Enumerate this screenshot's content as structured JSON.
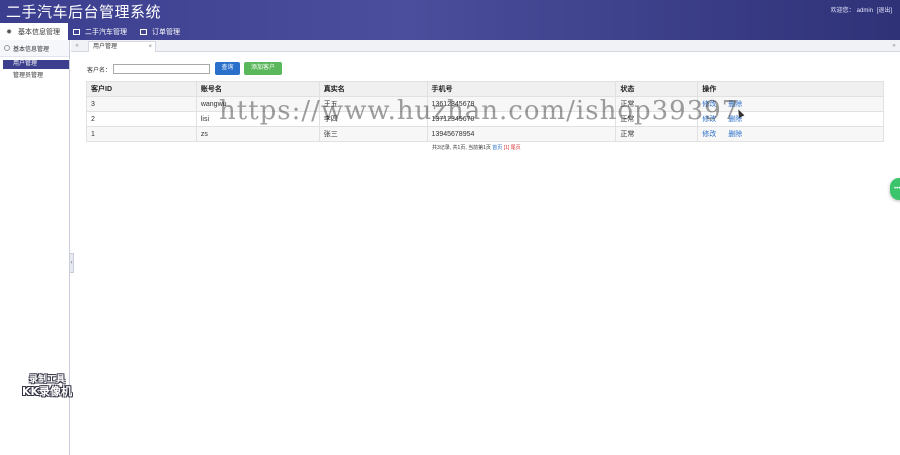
{
  "header": {
    "title": "二手汽车后台管理系统",
    "welcome": "欢迎您：",
    "username": "admin",
    "logout": "[退出]"
  },
  "nav": {
    "tabs": [
      {
        "label": "基本信息管理",
        "icon": "gear-icon"
      },
      {
        "label": "二手汽车管理",
        "icon": "list-icon"
      },
      {
        "label": "订单管理",
        "icon": "list-icon"
      }
    ]
  },
  "sidebar": {
    "title": "基本信息管理",
    "items": [
      {
        "label": "用户管理"
      },
      {
        "label": "管理员管理"
      }
    ]
  },
  "content_tab": {
    "label": "用户管理",
    "close": "×"
  },
  "search": {
    "label": "客户名：",
    "value": "",
    "placeholder": "",
    "search_button": "查询",
    "add_button": "添加客户"
  },
  "table": {
    "columns": [
      "客户ID",
      "账号名",
      "真实名",
      "手机号",
      "状态",
      "操作"
    ],
    "rows": [
      {
        "id": "3",
        "account": "wangwu",
        "realname": "王五",
        "phone": "13612345678",
        "status": "正常",
        "edit": "修改",
        "delete": "删除"
      },
      {
        "id": "2",
        "account": "lisi",
        "realname": "李四",
        "phone": "13712345670",
        "status": "正常",
        "edit": "修改",
        "delete": "删除"
      },
      {
        "id": "1",
        "account": "zs",
        "realname": "张三",
        "phone": "13945678954",
        "status": "正常",
        "edit": "修改",
        "delete": "删除"
      }
    ]
  },
  "pager": {
    "summary": "共3记录, 共1页, 当前第1页",
    "first": "首页",
    "current": "[1]",
    "last": "尾页"
  },
  "overlay": {
    "watermark": "https://www.huzhan.com/ishop39397",
    "recorder_line1": "录制工具",
    "recorder_line2": "KK录像机"
  },
  "colors": {
    "header_bg": "#3b3e8e",
    "accent_blue": "#2a6fc9",
    "accent_green": "#5bb75b",
    "sidebar_active": "#3b3f8d"
  }
}
